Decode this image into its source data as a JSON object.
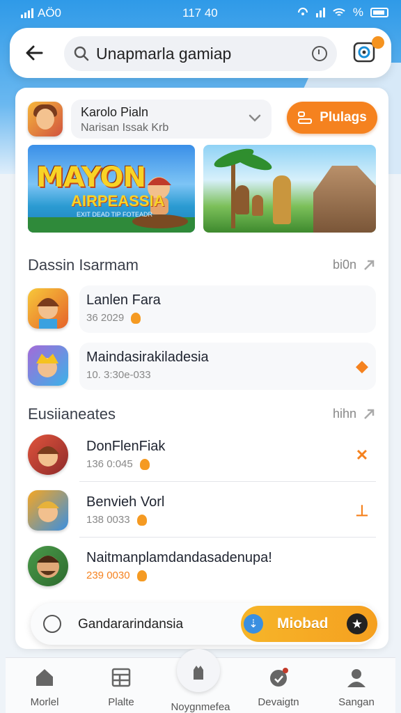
{
  "status_bar": {
    "left": "AÖ0",
    "time": "117 40",
    "right_symbol": "%"
  },
  "header": {
    "search_text": "Unapmarla gamiap"
  },
  "featured": {
    "title": "Karolo Pialn",
    "subtitle": "Narisan Issak Krb",
    "play_label": "Plulags"
  },
  "banners": {
    "banner1_title": "MAYON",
    "banner1_title2": "AIRPEASSIA",
    "banner1_sub": "EXIT DEAD TIP FOTEADR"
  },
  "section1": {
    "title": "Dassin Isarmam",
    "more": "bi0n",
    "items": [
      {
        "name": "Lanlen Fara",
        "meta": "36  2029"
      },
      {
        "name": "Maindasirakiladesia",
        "meta": "10. 3:30e-033",
        "action": "◆"
      }
    ]
  },
  "section2": {
    "title": "Eusiianeates",
    "more": "hihn",
    "items": [
      {
        "name": "DonFlenFiak",
        "meta": "136  0:045",
        "action": "✕"
      },
      {
        "name": "Benvieh Vorl",
        "meta": "138  0033",
        "action": "⊥"
      },
      {
        "name": "Naitmanplamdandasadenupa!",
        "meta": "239  0030"
      }
    ]
  },
  "bottom_pill": {
    "text": "Gandararindansia",
    "button": "Miobad"
  },
  "nav": {
    "items": [
      {
        "label": "Morlel",
        "icon": "home-icon"
      },
      {
        "label": "Plalte",
        "icon": "grid-icon"
      },
      {
        "label": "Noygnmefea",
        "icon": "hand-icon"
      },
      {
        "label": "Devaigtn",
        "icon": "badge-icon"
      },
      {
        "label": "Sangan",
        "icon": "person-icon"
      }
    ]
  },
  "colors": {
    "accent": "#f5821f",
    "blue": "#2f9ae8"
  }
}
